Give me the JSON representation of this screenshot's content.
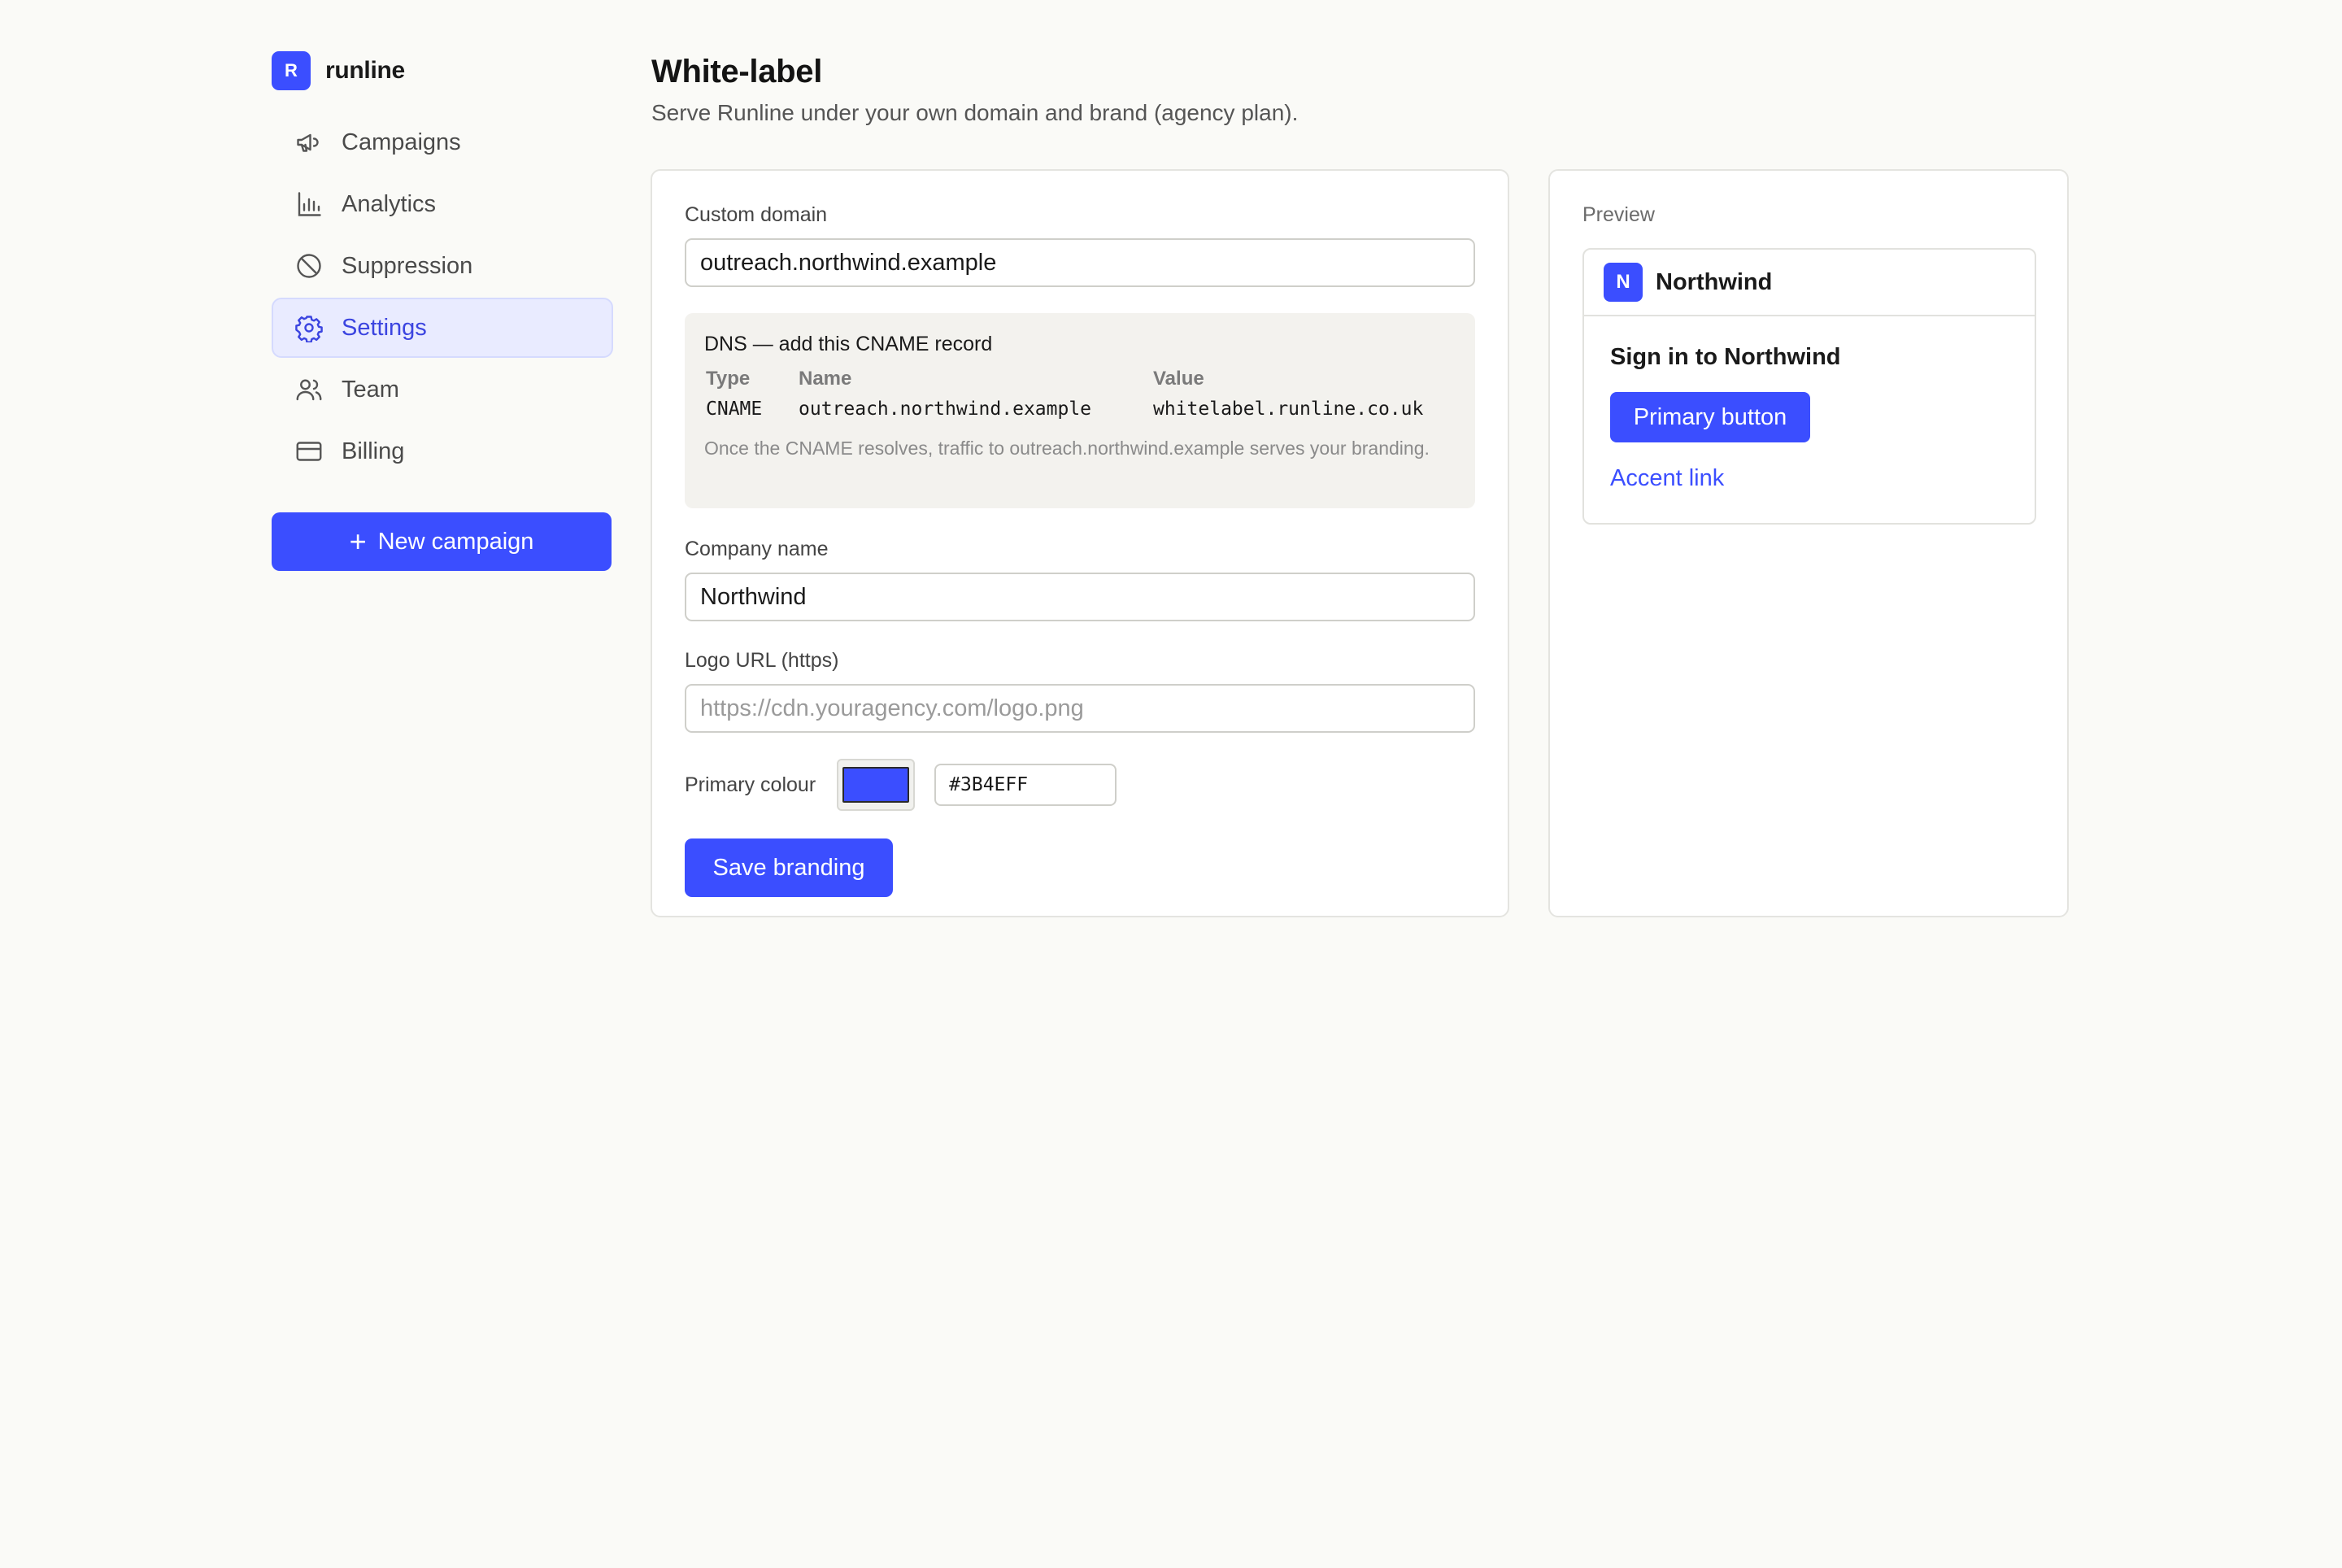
{
  "brand": {
    "initial": "R",
    "name": "runline"
  },
  "colors": {
    "accent": "#3B4EFF",
    "active_nav_bg": "#e9ebff",
    "page_bg": "#fafaf7"
  },
  "sidebar": {
    "items": [
      {
        "label": "Campaigns",
        "icon": "megaphone-icon"
      },
      {
        "label": "Analytics",
        "icon": "bar-chart-icon"
      },
      {
        "label": "Suppression",
        "icon": "ban-icon"
      },
      {
        "label": "Settings",
        "icon": "gear-icon",
        "active": true
      },
      {
        "label": "Team",
        "icon": "users-icon"
      },
      {
        "label": "Billing",
        "icon": "credit-card-icon"
      }
    ],
    "new_campaign_label": "New campaign"
  },
  "header": {
    "title": "White-label",
    "subtitle": "Serve Runline under your own domain and brand (agency plan)."
  },
  "form": {
    "custom_domain": {
      "label": "Custom domain",
      "value": "outreach.northwind.example"
    },
    "dns": {
      "title": "DNS — add this CNAME record",
      "columns": [
        "Type",
        "Name",
        "Value"
      ],
      "row": {
        "type": "CNAME",
        "name": "outreach.northwind.example",
        "value": "whitelabel.runline.co.uk"
      },
      "note": "Once the CNAME resolves, traffic to outreach.northwind.example serves your branding."
    },
    "company_name": {
      "label": "Company name",
      "value": "Northwind"
    },
    "logo_url": {
      "label": "Logo URL (https)",
      "value": "",
      "placeholder": "https://cdn.youragency.com/logo.png"
    },
    "primary_colour": {
      "label": "Primary colour",
      "value": "#3B4EFF"
    },
    "save_label": "Save branding"
  },
  "preview": {
    "label": "Preview",
    "logo_initial": "N",
    "company": "Northwind",
    "heading": "Sign in to Northwind",
    "primary_button": "Primary button",
    "accent_link": "Accent link"
  }
}
